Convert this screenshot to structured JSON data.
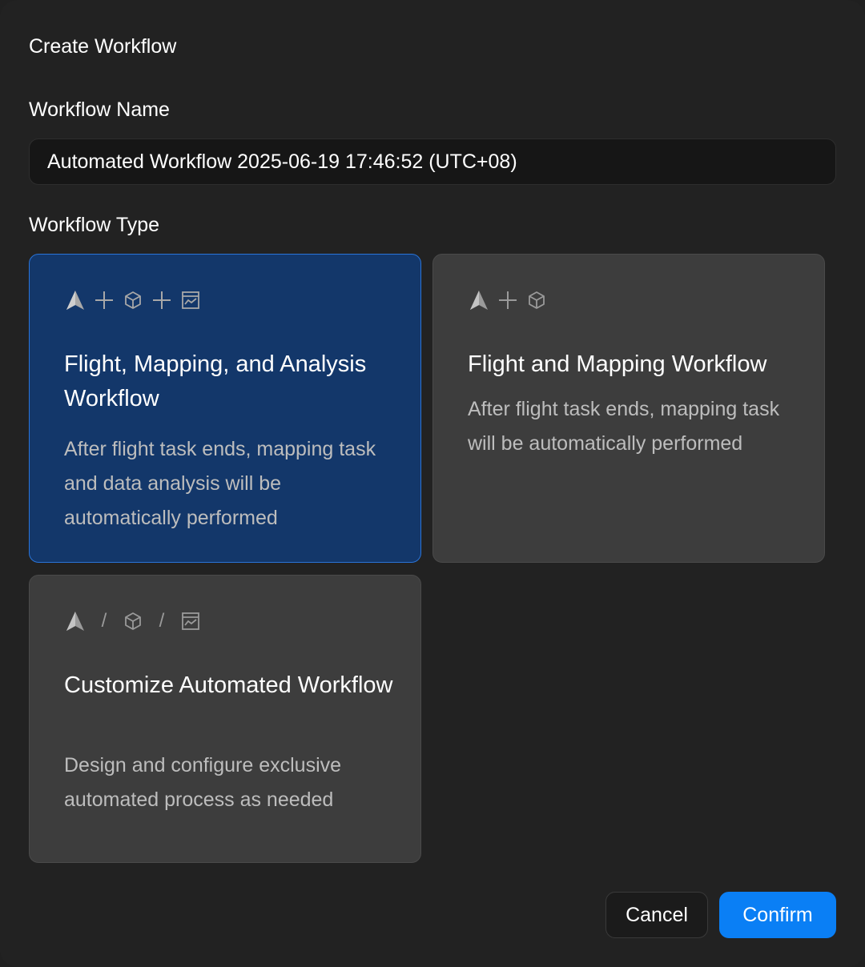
{
  "dialog": {
    "title": "Create Workflow",
    "name_label": "Workflow Name",
    "name_value": "Automated Workflow 2025-06-19 17:46:52 (UTC+08)",
    "type_label": "Workflow Type"
  },
  "cards": [
    {
      "title": "Flight, Mapping, and Analysis Workflow",
      "description": "After flight task ends, mapping task and data analysis will be automatically performed",
      "selected": true,
      "icons": [
        "flight-icon",
        "plus-icon",
        "mapping-cube-icon",
        "plus-icon",
        "analysis-chart-icon"
      ]
    },
    {
      "title": "Flight and Mapping Workflow",
      "description": "After flight task ends, mapping task will be automatically performed",
      "selected": false,
      "icons": [
        "flight-icon",
        "plus-icon",
        "mapping-cube-icon"
      ]
    },
    {
      "title": "Customize Automated Workflow",
      "description": "Design and configure exclusive automated process as needed",
      "selected": false,
      "icons": [
        "flight-icon",
        "slash",
        "mapping-cube-icon",
        "slash",
        "analysis-chart-icon"
      ]
    }
  ],
  "icon_separators": {
    "slash": "/"
  },
  "buttons": {
    "cancel": "Cancel",
    "confirm": "Confirm"
  },
  "colors": {
    "selected_card": "#13376a",
    "selected_border": "#2a74d8",
    "card": "#3d3d3d",
    "confirm": "#0a7ff5",
    "background": "#222222"
  }
}
